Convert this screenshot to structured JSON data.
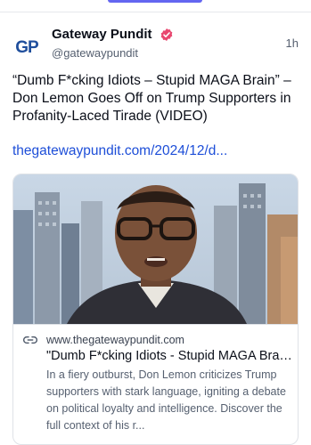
{
  "post": {
    "author_name": "Gateway Pundit",
    "author_handle": "@gatewaypundit",
    "avatar_text": "GP",
    "timestamp": "1h",
    "text": "“Dumb F*cking Idiots – Stupid MAGA Brain” – Don Lemon Goes Off on Trump Supporters in Profanity-Laced Tirade (VIDEO)",
    "link_text": "thegatewaypundit.com/2024/12/d...",
    "verified_color": "#e8476f"
  },
  "card": {
    "domain": "www.thegatewaypundit.com",
    "title": "\"Dumb F*cking Idiots - Stupid MAGA Brain\" - Don Lemon Goes Off on Trump Supporters in Profanity-Laced Tirade (VIDEO)",
    "description": "In a fiery outburst, Don Lemon criticizes Trump supporters with stark language, igniting a debate on political loyalty and intelligence. Discover the full context of his r..."
  },
  "colors": {
    "accent": "#6366f1",
    "link": "#1d4ed8"
  }
}
